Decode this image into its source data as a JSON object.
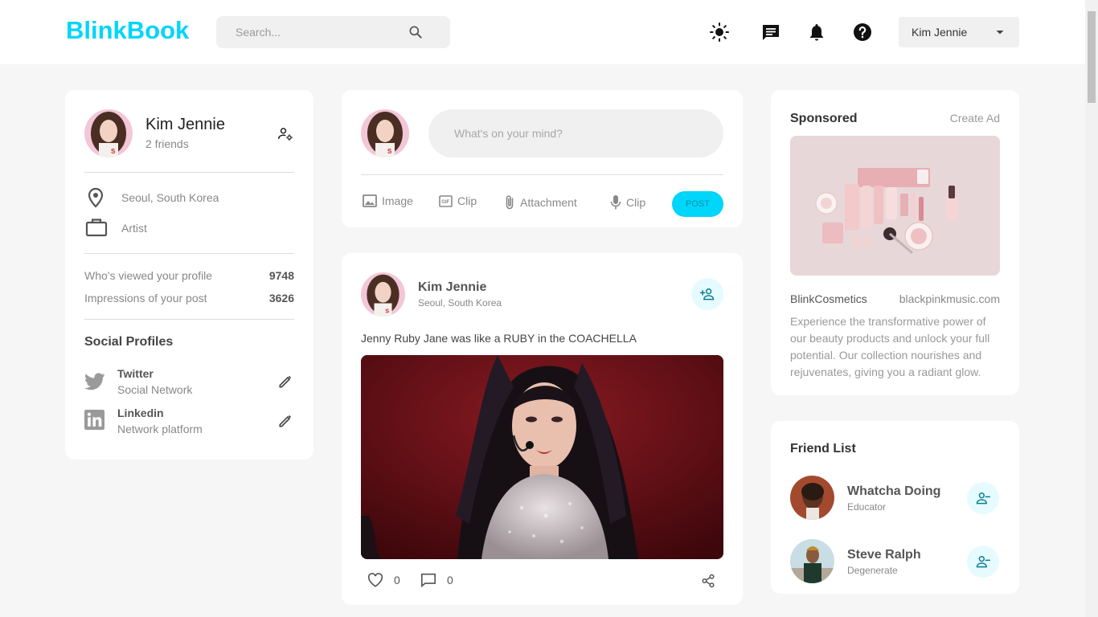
{
  "navbar": {
    "logo": "BlinkBook",
    "search_placeholder": "Search...",
    "user_name": "Kim Jennie",
    "icons": [
      "search-icon",
      "light-mode-icon",
      "messages-icon",
      "notifications-icon",
      "help-icon",
      "chevron-down-icon"
    ]
  },
  "profile": {
    "name": "Kim Jennie",
    "friends": "2 friends",
    "location": "Seoul, South Korea",
    "occupation": "Artist",
    "stats": [
      {
        "label": "Who's viewed your profile",
        "value": "9748"
      },
      {
        "label": "Impressions of your post",
        "value": "3626"
      }
    ],
    "social_title": "Social Profiles",
    "social": [
      {
        "name": "Twitter",
        "type": "Social Network"
      },
      {
        "name": "Linkedin",
        "type": "Network platform"
      }
    ]
  },
  "composer": {
    "placeholder": "What's on your mind?",
    "actions": [
      {
        "label": "Image",
        "icon": "image-icon"
      },
      {
        "label": "Clip",
        "icon": "gif-icon"
      },
      {
        "label": "Attachment",
        "icon": "attachment-icon"
      },
      {
        "label": "Clip",
        "icon": "microphone-icon"
      }
    ],
    "post_label": "POST"
  },
  "post": {
    "author": "Kim Jennie",
    "location": "Seoul, South Korea",
    "text": "Jenny Ruby Jane was like a RUBY in the COACHELLA",
    "likes": "0",
    "comments": "0"
  },
  "sponsored": {
    "title": "Sponsored",
    "create_ad": "Create Ad",
    "brand": "BlinkCosmetics",
    "site": "blackpinkmusic.com",
    "description": "Experience the transformative power of our beauty products and unlock your full potential. Our collection nourishes and rejuvenates, giving you a radiant glow."
  },
  "friend_list": {
    "title": "Friend List",
    "friends": [
      {
        "name": "Whatcha Doing",
        "role": "Educator"
      },
      {
        "name": "Steve Ralph",
        "role": "Degenerate"
      }
    ]
  },
  "colors": {
    "accent": "#00d5fa",
    "page_bg": "#f6f6f6",
    "card_bg": "#ffffff"
  }
}
